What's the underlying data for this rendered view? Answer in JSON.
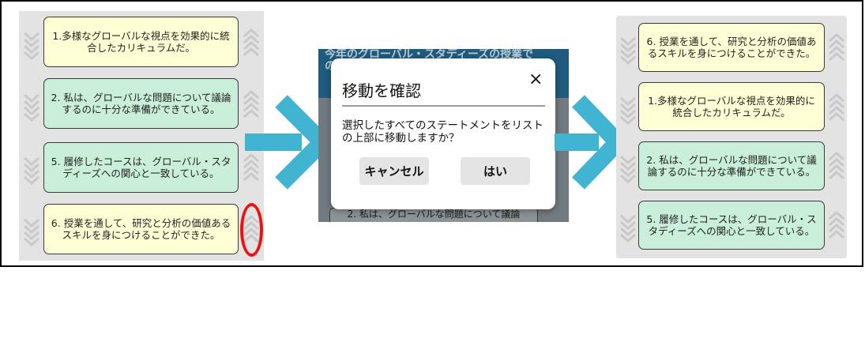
{
  "left_list": {
    "cards": [
      {
        "text": "1.多様なグローバルな視点を効果的に統合したカリキュラムだ。",
        "color": "#ffffd6"
      },
      {
        "text": "2. 私は、グローバルな問題について議論するのに十分な準備ができている。",
        "color": "#c9eed9"
      },
      {
        "text": "5. 履修したコースは、グローバル・スタディーズへの関心と一致している。",
        "color": "#c9eed9"
      },
      {
        "text": "6. 授業を通して、研究と分析の価値あるスキルを身につけることができた。",
        "color": "#ffffd6"
      }
    ]
  },
  "background_screen": {
    "header": "今年のグローバル・スタディーズの授業で",
    "header_partial": "の",
    "row_partial": "2. 私は、グローバルな問題について議論"
  },
  "dialog": {
    "title": "移動を確認",
    "close": "×",
    "message": "選択したすべてのステートメントをリストの上部に移動しますか？",
    "cancel_label": "キャンセル",
    "confirm_label": "はい"
  },
  "right_list": {
    "cards": [
      {
        "text": "6. 授業を通して、研究と分析の価値あるスキルを身につけることができた。",
        "color": "#ffffd6"
      },
      {
        "text": "1.多様なグローバルな視点を効果的に統合したカリキュラムだ。",
        "color": "#ffffd6"
      },
      {
        "text": "2. 私は、グローバルな問題について議論するのに十分な準備ができている。",
        "color": "#c9eed9"
      },
      {
        "text": "5. 履修したコースは、グローバル・スタディーズへの関心と一致している。",
        "color": "#c9eed9"
      }
    ]
  },
  "colors": {
    "arrow": "#41b4d2",
    "highlight_ring": "#e11111",
    "header": "#1f5b7e"
  },
  "icons": [
    "chevron-down-icon",
    "chevron-up-icon",
    "close-icon",
    "arrow-right-icon"
  ]
}
